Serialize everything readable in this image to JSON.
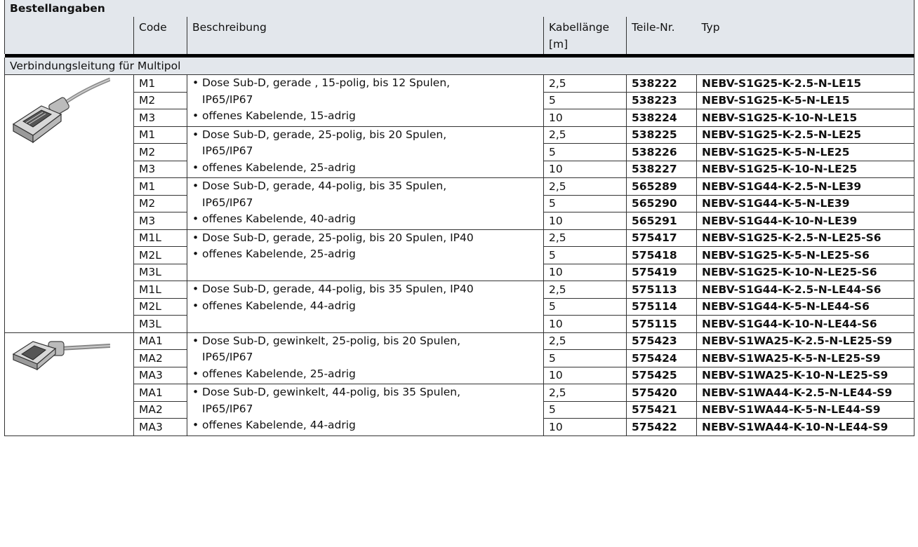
{
  "title": "Bestellangaben",
  "headers": {
    "code": "Code",
    "beschreibung": "Beschreibung",
    "kabellaenge_line1": "Kabellänge",
    "kabellaenge_line2": "[m]",
    "teile_nr": "Teile-Nr.",
    "typ": "Typ"
  },
  "section": "Verbindungsleitung für Multipol",
  "icons": {
    "straight_connector": "sub-d-straight-connector-icon",
    "angled_connector": "sub-d-angled-connector-icon"
  },
  "groups": [
    {
      "desc": [
        {
          "bullet": true,
          "text": "Dose Sub-D, gerade , 15-polig, bis 12 Spulen,"
        },
        {
          "bullet": false,
          "text": "IP65/IP67"
        },
        {
          "bullet": true,
          "text": "offenes Kabelende, 15-adrig"
        }
      ],
      "rows": [
        {
          "code": "M1",
          "len": "2,5",
          "nr": "538222",
          "typ": "NEBV-S1G25-K-2.5-N-LE15"
        },
        {
          "code": "M2",
          "len": "5",
          "nr": "538223",
          "typ": "NEBV-S1G25-K-5-N-LE15"
        },
        {
          "code": "M3",
          "len": "10",
          "nr": "538224",
          "typ": "NEBV-S1G25-K-10-N-LE15"
        }
      ]
    },
    {
      "desc": [
        {
          "bullet": true,
          "text": "Dose Sub-D, gerade, 25-polig, bis 20 Spulen,"
        },
        {
          "bullet": false,
          "text": "IP65/IP67"
        },
        {
          "bullet": true,
          "text": "offenes Kabelende, 25-adrig"
        }
      ],
      "rows": [
        {
          "code": "M1",
          "len": "2,5",
          "nr": "538225",
          "typ": "NEBV-S1G25-K-2.5-N-LE25"
        },
        {
          "code": "M2",
          "len": "5",
          "nr": "538226",
          "typ": "NEBV-S1G25-K-5-N-LE25"
        },
        {
          "code": "M3",
          "len": "10",
          "nr": "538227",
          "typ": "NEBV-S1G25-K-10-N-LE25"
        }
      ]
    },
    {
      "desc": [
        {
          "bullet": true,
          "text": "Dose Sub-D, gerade, 44-polig, bis 35 Spulen,"
        },
        {
          "bullet": false,
          "text": "IP65/IP67"
        },
        {
          "bullet": true,
          "text": "offenes Kabelende, 40-adrig"
        }
      ],
      "rows": [
        {
          "code": "M1",
          "len": "2,5",
          "nr": "565289",
          "typ": "NEBV-S1G44-K-2.5-N-LE39"
        },
        {
          "code": "M2",
          "len": "5",
          "nr": "565290",
          "typ": "NEBV-S1G44-K-5-N-LE39"
        },
        {
          "code": "M3",
          "len": "10",
          "nr": "565291",
          "typ": "NEBV-S1G44-K-10-N-LE39"
        }
      ]
    },
    {
      "desc": [
        {
          "bullet": true,
          "text": "Dose Sub-D, gerade, 25-polig, bis 20 Spulen, IP40"
        },
        {
          "bullet": true,
          "text": "offenes Kabelende, 25-adrig"
        }
      ],
      "rows": [
        {
          "code": "M1L",
          "len": "2,5",
          "nr": "575417",
          "typ": "NEBV-S1G25-K-2.5-N-LE25-S6"
        },
        {
          "code": "M2L",
          "len": "5",
          "nr": "575418",
          "typ": "NEBV-S1G25-K-5-N-LE25-S6"
        },
        {
          "code": "M3L",
          "len": "10",
          "nr": "575419",
          "typ": "NEBV-S1G25-K-10-N-LE25-S6"
        }
      ]
    },
    {
      "desc": [
        {
          "bullet": true,
          "text": "Dose Sub-D, gerade, 44-polig, bis 35 Spulen, IP40"
        },
        {
          "bullet": true,
          "text": "offenes Kabelende, 44-adrig"
        }
      ],
      "rows": [
        {
          "code": "M1L",
          "len": "2,5",
          "nr": "575113",
          "typ": "NEBV-S1G44-K-2.5-N-LE44-S6"
        },
        {
          "code": "M2L",
          "len": "5",
          "nr": "575114",
          "typ": "NEBV-S1G44-K-5-N-LE44-S6"
        },
        {
          "code": "M3L",
          "len": "10",
          "nr": "575115",
          "typ": "NEBV-S1G44-K-10-N-LE44-S6"
        }
      ]
    },
    {
      "desc": [
        {
          "bullet": true,
          "text": "Dose Sub-D, gewinkelt, 25-polig, bis 20 Spulen,"
        },
        {
          "bullet": false,
          "text": "IP65/IP67"
        },
        {
          "bullet": true,
          "text": "offenes Kabelende, 25-adrig"
        }
      ],
      "rows": [
        {
          "code": "MA1",
          "len": "2,5",
          "nr": "575423",
          "typ": "NEBV-S1WA25-K-2.5-N-LE25-S9"
        },
        {
          "code": "MA2",
          "len": "5",
          "nr": "575424",
          "typ": "NEBV-S1WA25-K-5-N-LE25-S9"
        },
        {
          "code": "MA3",
          "len": "10",
          "nr": "575425",
          "typ": "NEBV-S1WA25-K-10-N-LE25-S9"
        }
      ]
    },
    {
      "desc": [
        {
          "bullet": true,
          "text": "Dose Sub-D, gewinkelt, 44-polig, bis 35 Spulen,"
        },
        {
          "bullet": false,
          "text": "IP65/IP67"
        },
        {
          "bullet": true,
          "text": "offenes Kabelende, 44-adrig"
        }
      ],
      "rows": [
        {
          "code": "MA1",
          "len": "2,5",
          "nr": "575420",
          "typ": "NEBV-S1WA44-K-2.5-N-LE44-S9"
        },
        {
          "code": "MA2",
          "len": "5",
          "nr": "575421",
          "typ": "NEBV-S1WA44-K-5-N-LE44-S9"
        },
        {
          "code": "MA3",
          "len": "10",
          "nr": "575422",
          "typ": "NEBV-S1WA44-K-10-N-LE44-S9"
        }
      ]
    }
  ]
}
